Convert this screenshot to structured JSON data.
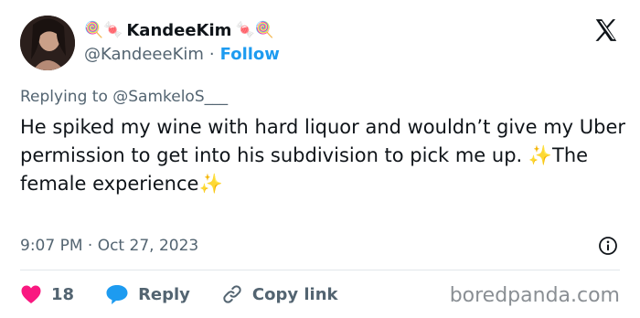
{
  "author": {
    "name": "KandeeKim",
    "handle": "@KandeeeKim",
    "follow_label": "Follow",
    "separator": "·",
    "name_prefix_emoji": "🍭🍬",
    "name_suffix_emoji": "🍬🍭"
  },
  "replying_to": "Replying to @SamkeloS___",
  "tweet": {
    "text": "He spiked my wine with hard liquor and wouldn’t give my Uber permission to get into his subdivision to pick me up. ✨The female experience✨"
  },
  "timestamp": "9:07 PM · Oct 27, 2023",
  "actions": {
    "like_count": "18",
    "reply_label": "Reply",
    "copy_link_label": "Copy link"
  },
  "watermark": "boredpanda.com",
  "icons": {
    "x_logo": "x-logo-icon",
    "info": "info-icon",
    "heart": "heart-icon",
    "reply": "reply-bubble-icon",
    "link": "link-icon"
  },
  "colors": {
    "like": "#f91880",
    "reply": "#1d9bf0",
    "follow": "#1d9bf0",
    "muted": "#536471"
  }
}
